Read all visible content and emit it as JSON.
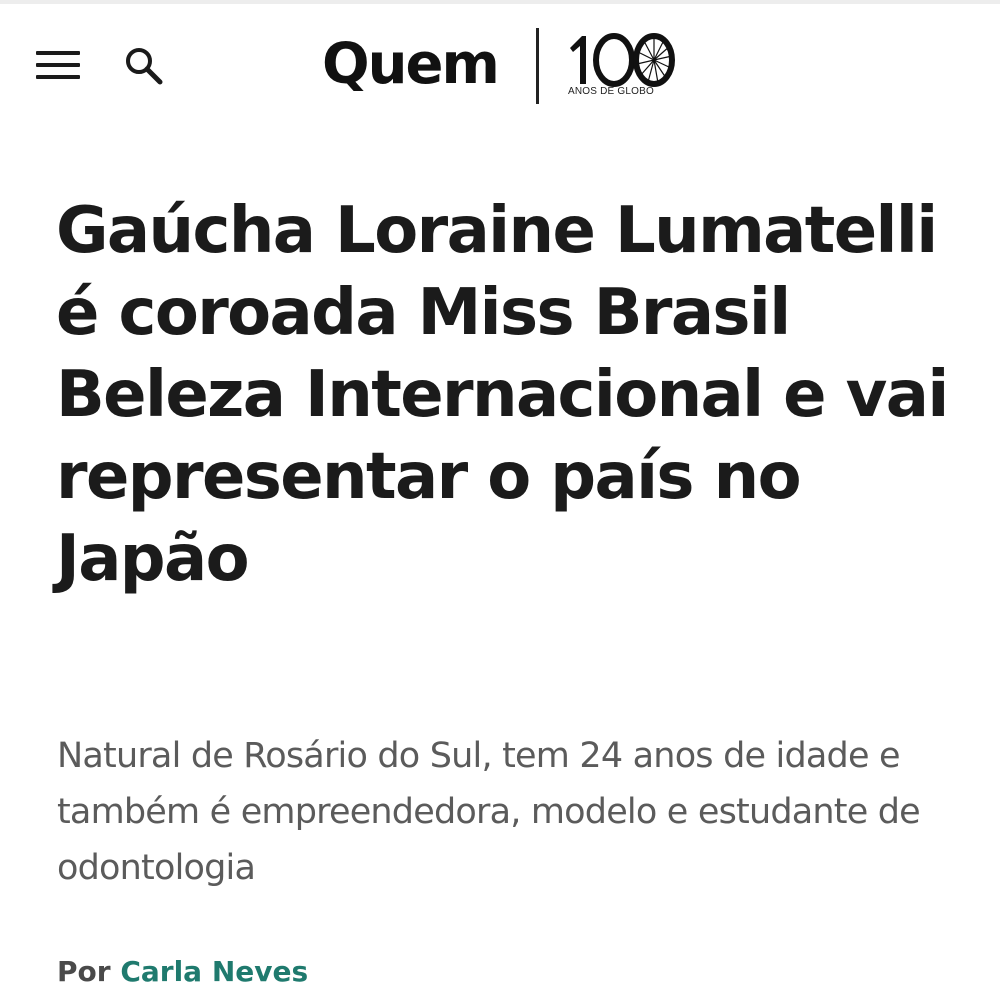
{
  "header": {
    "menu_icon": "hamburger-menu-icon",
    "search_icon": "search-icon",
    "logo_text": "Quem",
    "anniversary_number": "100",
    "anniversary_text": "ANOS DE GLOBO"
  },
  "article": {
    "headline": "Gaúcha Loraine Lumatelli é coroada Miss Brasil Beleza Internacional e vai representar o país no Japão",
    "subtitle": "Natural de Rosário do Sul, tem 24 anos de idade e também é empreendedora, modelo e estudante de odontologia",
    "byline_prefix": "Por",
    "author": "Carla Neves"
  },
  "colors": {
    "text": "#1b1b1b",
    "subtitle": "#5b5b5b",
    "author_link": "#1f7a6e",
    "background": "#ffffff"
  }
}
